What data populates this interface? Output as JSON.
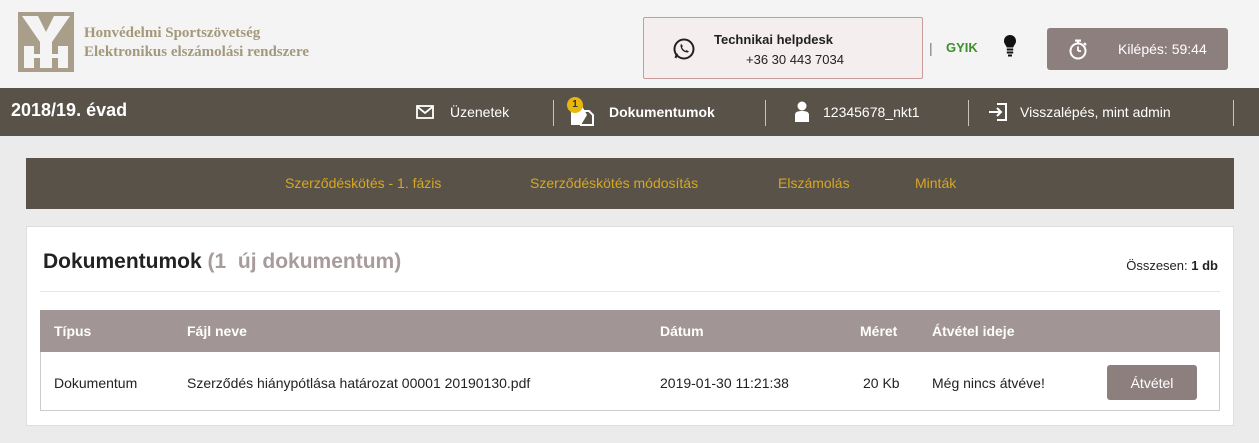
{
  "header": {
    "brand_line1": "Honvédelmi Sportszövetség",
    "brand_line2": "Elektronikus elszámolási rendszere",
    "helpdesk_title": "Technikai helpdesk",
    "helpdesk_phone": "+36 30 443 7034",
    "gyik_separator": "|",
    "gyik_label": "GYIK",
    "logout_label": "Kilépés: 59:44"
  },
  "topbar": {
    "season": "2018/19. évad",
    "messages_label": "Üzenetek",
    "documents_label": "Dokumentumok",
    "documents_badge": "1",
    "user_label": "12345678_nkt1",
    "back_as_admin_label": "Visszalépés, mint admin"
  },
  "submenu": [
    {
      "label": "Szerződéskötés - 1. fázis"
    },
    {
      "label": "Szerződéskötés módosítás"
    },
    {
      "label": "Elszámolás"
    },
    {
      "label": "Minták"
    }
  ],
  "panel": {
    "title": "Dokumentumok",
    "new_count_label": "(1  új dokumentum)",
    "total_label": "Összesen:",
    "total_value": "1 db"
  },
  "table": {
    "headers": [
      "Típus",
      "Fájl neve",
      "Dátum",
      "Méret",
      "Átvétel ideje"
    ],
    "rows": [
      {
        "type": "Dokumentum",
        "file_name": "Szerződés hiánypótlása határozat 00001 20190130.pdf",
        "date": "2019-01-30 11:21:38",
        "size": "20 Kb",
        "received_at": "Még nincs átvéve!",
        "action_label": "Átvétel"
      }
    ]
  },
  "colors": {
    "header_bg": "#f4f4f4",
    "topbar_bg": "#595248",
    "submenu_text": "#d6a723",
    "table_header_bg": "#a29595",
    "button_bg": "#8e7f7f",
    "gyik_green": "#3d8f2d",
    "badge_yellow": "#e8b70c",
    "brand_text": "#a3997a"
  },
  "icons": [
    "logo-icon",
    "whatsapp-icon",
    "lightbulb-icon",
    "stopwatch-icon",
    "envelope-icon",
    "document-icon",
    "user-icon",
    "exit-icon"
  ]
}
